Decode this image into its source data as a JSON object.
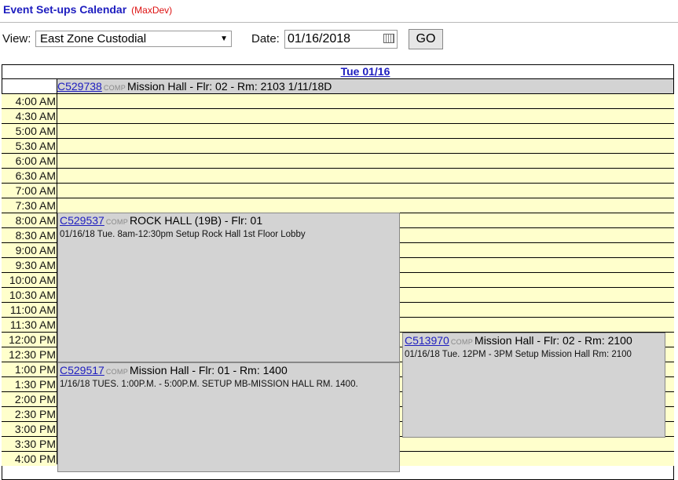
{
  "header": {
    "title": "Event Set-ups Calendar",
    "subtitle": "(MaxDev)"
  },
  "controls": {
    "view_label": "View:",
    "view_value": "East Zone Custodial",
    "date_label": "Date:",
    "date_value": "01/16/2018",
    "go_label": "GO"
  },
  "day": {
    "label": "Tue 01/16"
  },
  "all_day": {
    "code": "C529738",
    "tag": "COMP",
    "title": "Mission Hall - Flr: 02 - Rm: 2103 1/11/18D"
  },
  "times": [
    "4:00 AM",
    "4:30 AM",
    "5:00 AM",
    "5:30 AM",
    "6:00 AM",
    "6:30 AM",
    "7:00 AM",
    "7:30 AM",
    "8:00 AM",
    "8:30 AM",
    "9:00 AM",
    "9:30 AM",
    "10:00 AM",
    "10:30 AM",
    "11:00 AM",
    "11:30 AM",
    "12:00 PM",
    "12:30 PM",
    "1:00 PM",
    "1:30 PM",
    "2:00 PM",
    "2:30 PM",
    "3:00 PM",
    "3:30 PM",
    "4:00 PM"
  ],
  "events": [
    {
      "code": "C529537",
      "tag": "COMP",
      "title": "ROCK HALL (19B) - Flr: 01",
      "desc": "01/16/18 Tue. 8am-12:30pm Setup Rock Hall 1st Floor Lobby"
    },
    {
      "code": "C513970",
      "tag": "COMP",
      "title": "Mission Hall - Flr: 02 - Rm: 2100",
      "desc": "01/16/18 Tue. 12PM - 3PM Setup Mission Hall Rm: 2100"
    },
    {
      "code": "C529517",
      "tag": "COMP",
      "title": "Mission Hall - Flr: 01 - Rm: 1400",
      "desc": "1/16/18 TUES. 1:00P.M. - 5:00P.M. SETUP MB-MISSION HALL RM. 1400."
    }
  ]
}
